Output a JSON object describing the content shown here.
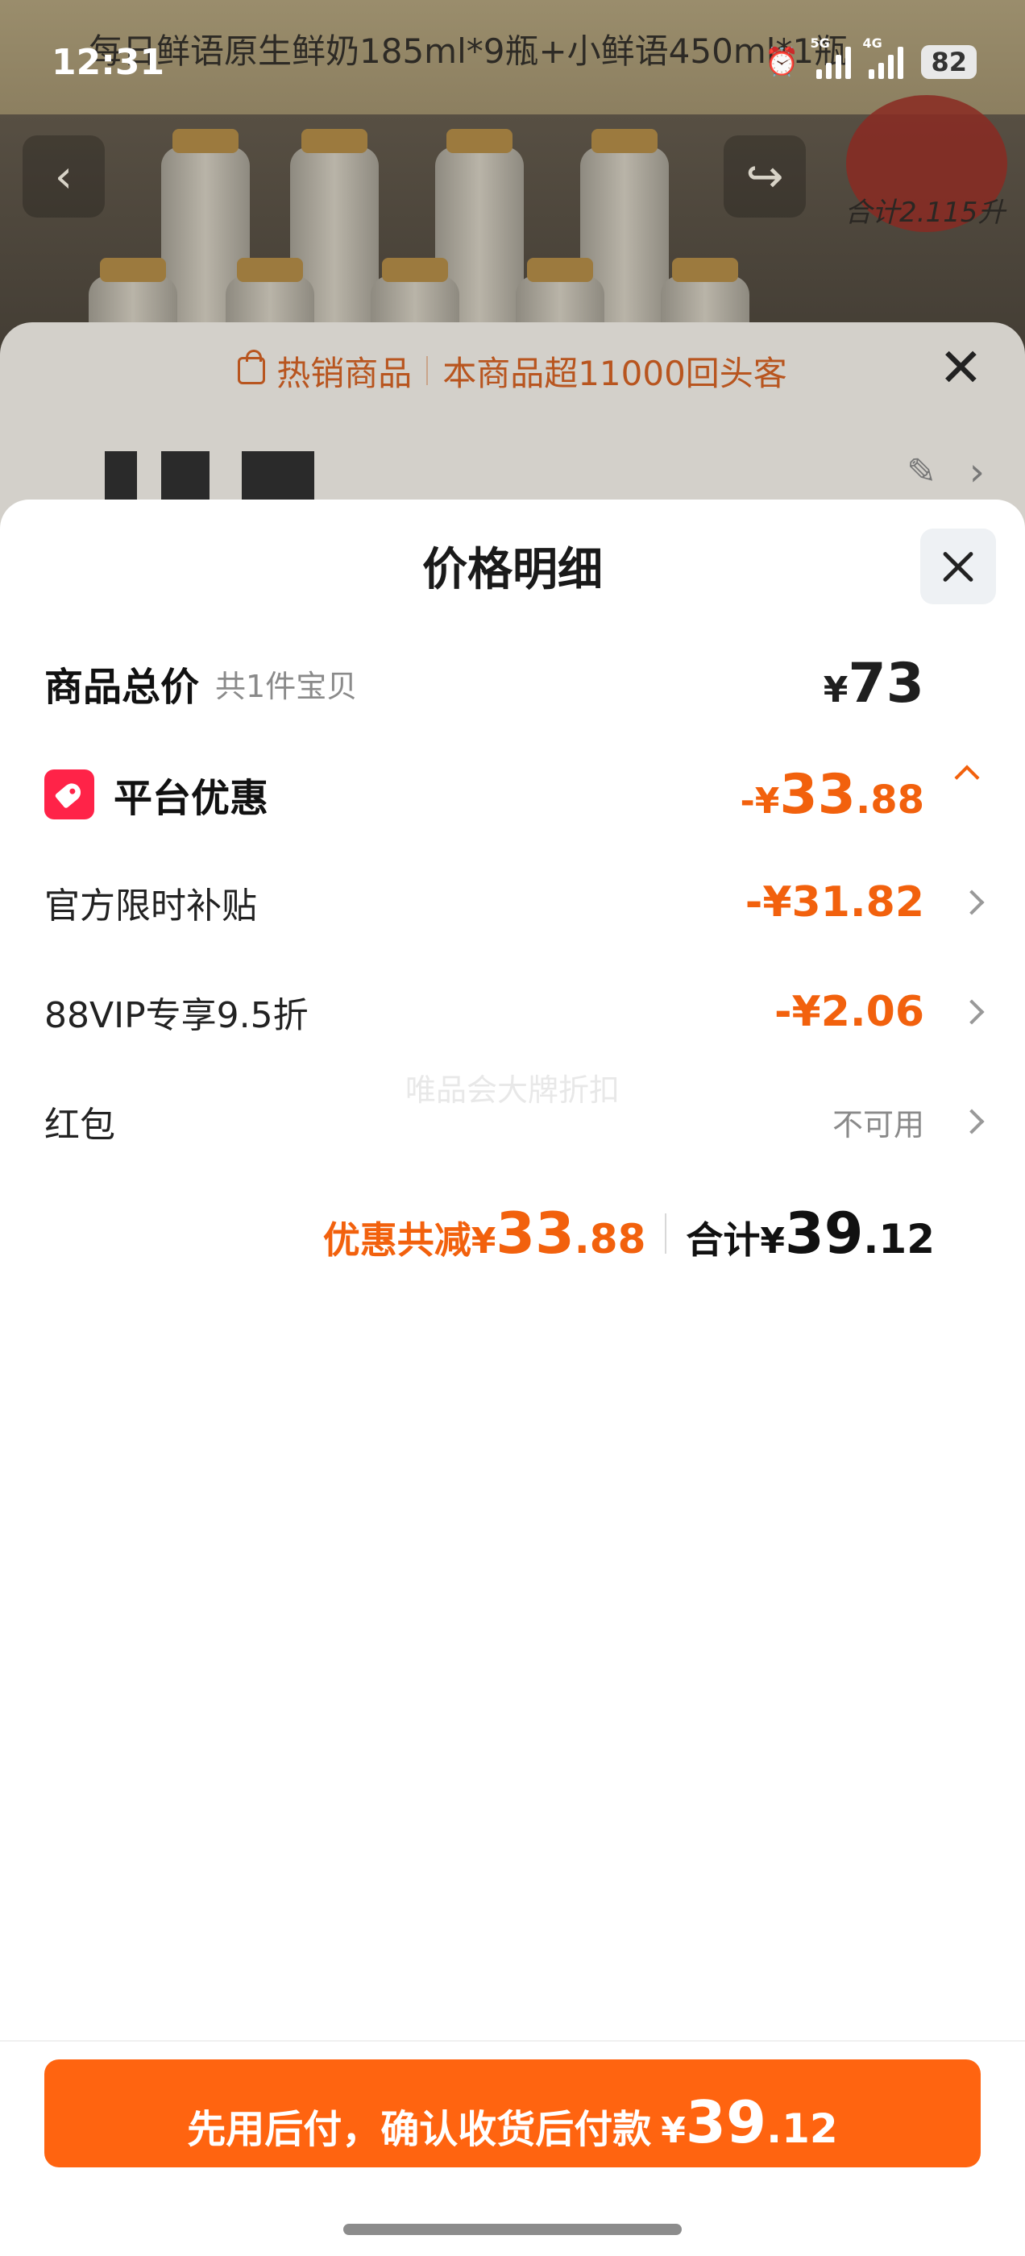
{
  "status_bar": {
    "time": "12:31",
    "network_1": "5G",
    "network_2": "4G",
    "battery": "82"
  },
  "background": {
    "product_title": "每日鲜语原生鲜奶185ml*9瓶+小鲜语450ml*1瓶",
    "promo_total": "合计2.115升",
    "hot_label": "热销商品",
    "hot_text": "本商品超11000回头客"
  },
  "sheet": {
    "title": "价格明细",
    "total": {
      "label": "商品总价",
      "sub": "共1件宝贝",
      "currency": "¥",
      "amount": "73"
    },
    "platform": {
      "label": "平台优惠",
      "prefix": "-¥",
      "int": "33",
      "dec": ".88"
    },
    "items": [
      {
        "label": "官方限时补贴",
        "value": "-¥31.82"
      },
      {
        "label": "88VIP专享9.5折",
        "value": "-¥2.06"
      },
      {
        "label": "红包",
        "value": "不可用"
      }
    ],
    "watermark": "唯品会大牌折扣",
    "summary": {
      "discount_label": "优惠共减",
      "discount_currency": "¥",
      "discount_int": "33",
      "discount_dec": ".88",
      "total_label": "合计",
      "total_currency": "¥",
      "total_int": "39",
      "total_dec": ".12"
    }
  },
  "footer": {
    "pay_label": "先用后付，确认收货后付款",
    "currency": "¥",
    "int": "39",
    "dec": ".12"
  },
  "colors": {
    "accent_orange": "#f2610d",
    "button_orange": "#ff6410",
    "tag_red": "#ff2348"
  }
}
